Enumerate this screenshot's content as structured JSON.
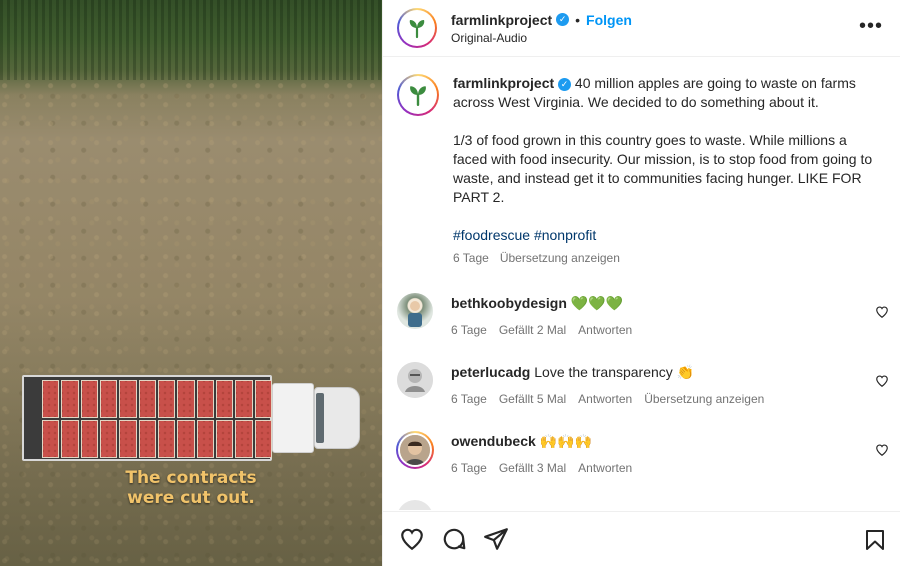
{
  "media": {
    "caption_line1": "The contracts",
    "caption_line2": "were cut out."
  },
  "header": {
    "username": "farmlinkproject",
    "follow_label": "Folgen",
    "separator": "•",
    "audio_label": "Original-Audio",
    "more_label": "•••"
  },
  "post": {
    "username": "farmlinkproject",
    "para1": "40 million apples are going to waste on farms across West Virginia. We decided to do something about it.",
    "para2": "1/3 of food grown in this country goes to waste. While millions a faced with food insecurity. Our mission, is to stop food from going to waste, and instead get it to communities facing hunger. LIKE FOR PART 2.",
    "hashtag1": "#foodrescue",
    "hashtag2": "#nonprofit",
    "age": "6 Tage",
    "translate": "Übersetzung anzeigen"
  },
  "comments": [
    {
      "username": "bethkoobydesign",
      "text": "💚💚💚",
      "age": "6 Tage",
      "likes": "Gefällt 2 Mal",
      "reply": "Antworten",
      "translate": ""
    },
    {
      "username": "peterlucadg",
      "text": "Love the transparency 👏",
      "age": "6 Tage",
      "likes": "Gefällt 5 Mal",
      "reply": "Antworten",
      "translate": "Übersetzung anzeigen"
    },
    {
      "username": "owendubeck",
      "text": "🙌🙌🙌",
      "age": "6 Tage",
      "likes": "Gefällt 3 Mal",
      "reply": "Antworten",
      "translate": ""
    }
  ],
  "colors": {
    "accent": "#0095f6",
    "verified": "#1d9bf0",
    "caption": "#f1c36a",
    "logo_green": "#3c8c3f"
  },
  "icons": {
    "footer": [
      "heart-icon",
      "comment-icon",
      "share-icon",
      "bookmark-icon"
    ],
    "header": [
      "more-options-icon",
      "verified-icon"
    ]
  }
}
